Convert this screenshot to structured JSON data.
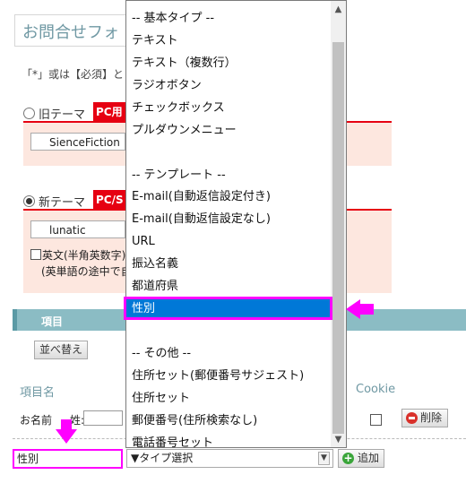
{
  "page": {
    "title": "お問合せフォ",
    "required_note": "「*」或は【必須】と"
  },
  "themes": {
    "old": {
      "label": "旧テーマ",
      "badge": "PC用",
      "selected_value": "SienceFiction"
    },
    "new": {
      "label": "新テーマ",
      "badge": "PC/S",
      "selected_value": "lunatic"
    },
    "english_check_label": "英文(半角英数字)",
    "english_note": "(英単語の途中で自"
  },
  "items": {
    "header": "項目",
    "sort_button": "並べ替え",
    "column_item_name": "項目名",
    "column_cookie": "Cookie",
    "row": {
      "name": "お名前",
      "sub_label": "姓:",
      "delete_button": "削除"
    },
    "new_item_name": "性別",
    "type_select_value": "▼タイプ選択",
    "add_button": "追加"
  },
  "dropdown": {
    "options": [
      "-- 基本タイプ --",
      "テキスト",
      "テキスト（複数行）",
      "ラジオボタン",
      "チェックボックス",
      "プルダウンメニュー",
      "",
      "-- テンプレート --",
      "E-mail(自動返信設定付き)",
      "E-mail(自動返信設定なし)",
      "URL",
      "振込名義",
      "都道府県",
      "性別",
      "",
      "-- その他 --",
      "住所セット(郵便番号サジェスト)",
      "住所セット",
      "郵便番号(住所検索なし)",
      "電話番号セット"
    ],
    "selected_index": 13
  },
  "colors": {
    "accent": "#0078d7",
    "highlight": "#ff00ff",
    "badge": "#e60012",
    "section_header": "#8bbcc4"
  }
}
